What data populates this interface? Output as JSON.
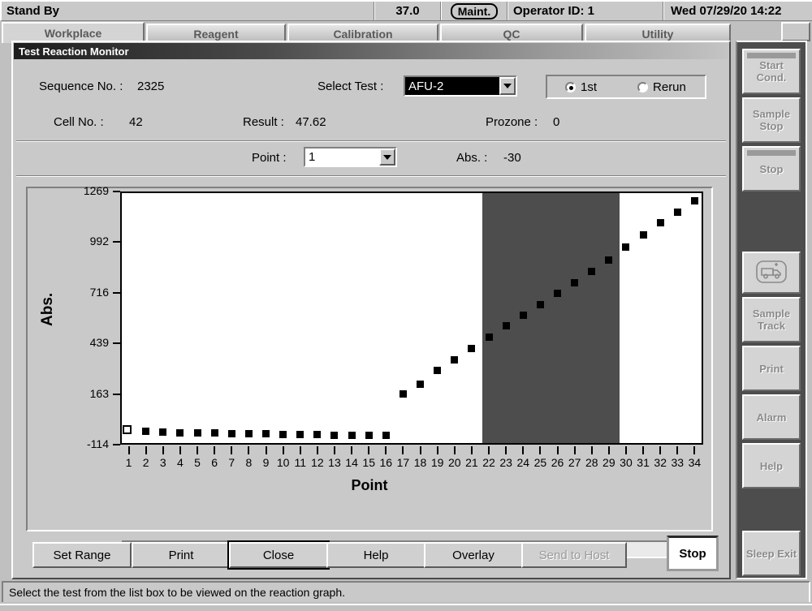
{
  "statusbar": {
    "machine_state": "Stand By",
    "temperature": "37.0",
    "maint_label": "Maint.",
    "operator": "Operator ID: 1",
    "datetime": "Wed 07/29/20 14:22"
  },
  "tabs": [
    {
      "label": "Workplace",
      "selected": true
    },
    {
      "label": "Reagent",
      "selected": false
    },
    {
      "label": "Calibration",
      "selected": false
    },
    {
      "label": "QC",
      "selected": false
    },
    {
      "label": "Utility",
      "selected": false
    }
  ],
  "dialog": {
    "title": "Test Reaction Monitor",
    "fields": {
      "sequence_no_label": "Sequence No. :",
      "sequence_no_value": "2325",
      "cell_no_label": "Cell No. :",
      "cell_no_value": "42",
      "result_label": "Result :",
      "result_value": "47.62",
      "select_test_label": "Select Test :",
      "select_test_value": "AFU-2",
      "prozone_label": "Prozone :",
      "prozone_value": "0",
      "point_label": "Point :",
      "point_value": "1",
      "abs_label": "Abs. :",
      "abs_value": "-30"
    },
    "run_mode": {
      "options": [
        "1st",
        "Rerun"
      ],
      "selected": "1st"
    },
    "buttons": [
      {
        "label": "Set Range",
        "enabled": true,
        "focused": false
      },
      {
        "label": "Print",
        "enabled": true,
        "focused": false
      },
      {
        "label": "Close",
        "enabled": true,
        "focused": true
      },
      {
        "label": "Help",
        "enabled": true,
        "focused": false
      },
      {
        "label": "Overlay",
        "enabled": true,
        "focused": false
      },
      {
        "label": "Send to Host",
        "enabled": false,
        "focused": false
      }
    ],
    "stop_button": "Stop",
    "scrollbar": {
      "left_arrow": "left-arrow",
      "right_arrow": "right-arrow"
    }
  },
  "sidebar": {
    "items": [
      {
        "label": "Start Cond.",
        "icon": null,
        "cap": true
      },
      {
        "label": "Sample Stop",
        "icon": null,
        "cap": false
      },
      {
        "label": "Stop",
        "icon": null,
        "cap": true
      },
      {
        "label": "",
        "icon": "ambulance-icon",
        "cap": false
      },
      {
        "label": "Sample Track",
        "icon": null,
        "cap": false
      },
      {
        "label": "Print",
        "icon": null,
        "cap": false
      },
      {
        "label": "Alarm",
        "icon": null,
        "cap": false
      },
      {
        "label": "Help",
        "icon": null,
        "cap": false
      },
      {
        "label": "Sleep Exit",
        "icon": null,
        "cap": false
      }
    ]
  },
  "message_bar": {
    "text": "Select the test from the list box to be viewed on the reaction graph."
  },
  "chart_data": {
    "type": "scatter",
    "title": "",
    "xlabel": "Point",
    "ylabel": "Abs.",
    "xlim": [
      0.5,
      34.5
    ],
    "ylim": [
      -114,
      1269
    ],
    "grid": false,
    "legend": null,
    "yticks": [
      -114,
      163,
      439,
      716,
      992,
      1269
    ],
    "ytick_labels": [
      "-114",
      "163",
      "439",
      "716",
      "992",
      "1269"
    ],
    "xticks": [
      1,
      2,
      3,
      4,
      5,
      6,
      7,
      8,
      9,
      10,
      11,
      12,
      13,
      14,
      15,
      16,
      17,
      18,
      19,
      20,
      21,
      22,
      23,
      24,
      25,
      26,
      27,
      28,
      29,
      30,
      31,
      32,
      33,
      34
    ],
    "xtick_labels": [
      "1",
      "2",
      "3",
      "4",
      "5",
      "6",
      "7",
      "8",
      "9",
      "10",
      "11",
      "12",
      "13",
      "14",
      "15",
      "16",
      "17",
      "18",
      "19",
      "20",
      "21",
      "22",
      "23",
      "24",
      "25",
      "26",
      "27",
      "28",
      "29",
      "30",
      "31",
      "32",
      "33",
      "34"
    ],
    "x": [
      1,
      2,
      3,
      4,
      5,
      6,
      7,
      8,
      9,
      10,
      11,
      12,
      13,
      14,
      15,
      16,
      17,
      18,
      19,
      20,
      21,
      22,
      23,
      24,
      25,
      26,
      27,
      28,
      29,
      30,
      31,
      32,
      33,
      34
    ],
    "values": [
      -30,
      -34,
      -38,
      -40,
      -42,
      -42,
      -44,
      -44,
      -46,
      -48,
      -48,
      -50,
      -52,
      -52,
      -54,
      -56,
      170,
      225,
      300,
      360,
      420,
      480,
      545,
      600,
      660,
      720,
      780,
      840,
      905,
      975,
      1040,
      1105,
      1165,
      1225
    ],
    "highlighted_index": 0,
    "highlight_note": "selected point 1 drawn as hollow marker",
    "shaded_region": {
      "label": "measurement window",
      "x_start": 21.6,
      "x_end": 29.6,
      "color": "#4d4d4d"
    }
  }
}
